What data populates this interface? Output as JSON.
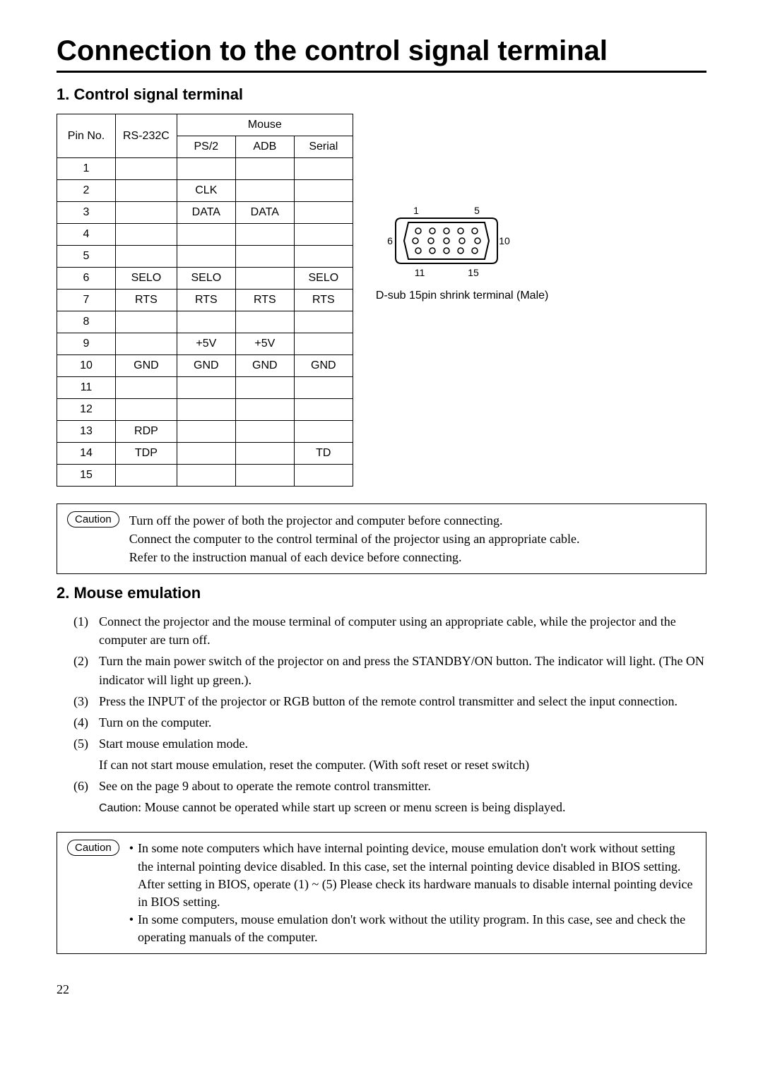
{
  "title": "Connection to the control signal terminal",
  "section1_title": "1. Control signal terminal",
  "table": {
    "headers": {
      "pin_no": "Pin No.",
      "rs232c": "RS-232C",
      "mouse": "Mouse",
      "ps2": "PS/2",
      "adb": "ADB",
      "serial": "Serial"
    },
    "rows": [
      {
        "pin": "1",
        "rs": "",
        "ps2": "",
        "adb": "",
        "ser": ""
      },
      {
        "pin": "2",
        "rs": "",
        "ps2": "CLK",
        "adb": "",
        "ser": ""
      },
      {
        "pin": "3",
        "rs": "",
        "ps2": "DATA",
        "adb": "DATA",
        "ser": ""
      },
      {
        "pin": "4",
        "rs": "",
        "ps2": "",
        "adb": "",
        "ser": ""
      },
      {
        "pin": "5",
        "rs": "",
        "ps2": "",
        "adb": "",
        "ser": ""
      },
      {
        "pin": "6",
        "rs": "SELO",
        "ps2": "SELO",
        "adb": "",
        "ser": "SELO"
      },
      {
        "pin": "7",
        "rs": "RTS",
        "ps2": "RTS",
        "adb": "RTS",
        "ser": "RTS"
      },
      {
        "pin": "8",
        "rs": "",
        "ps2": "",
        "adb": "",
        "ser": ""
      },
      {
        "pin": "9",
        "rs": "",
        "ps2": "+5V",
        "adb": "+5V",
        "ser": ""
      },
      {
        "pin": "10",
        "rs": "GND",
        "ps2": "GND",
        "adb": "GND",
        "ser": "GND"
      },
      {
        "pin": "11",
        "rs": "",
        "ps2": "",
        "adb": "",
        "ser": ""
      },
      {
        "pin": "12",
        "rs": "",
        "ps2": "",
        "adb": "",
        "ser": ""
      },
      {
        "pin": "13",
        "rs": "RDP",
        "ps2": "",
        "adb": "",
        "ser": ""
      },
      {
        "pin": "14",
        "rs": "TDP",
        "ps2": "",
        "adb": "",
        "ser": "TD"
      },
      {
        "pin": "15",
        "rs": "",
        "ps2": "",
        "adb": "",
        "ser": ""
      }
    ]
  },
  "connector": {
    "labels": {
      "p1": "1",
      "p5": "5",
      "p6": "6",
      "p10": "10",
      "p11": "11",
      "p15": "15"
    },
    "caption": "D-sub 15pin shrink terminal (Male)"
  },
  "caution1": {
    "label": "Caution",
    "lines": [
      "Turn off the power of both the projector and computer before connecting.",
      "Connect the computer to the control terminal of the projector using an appropriate cable.",
      "Refer to the instruction manual of each device before connecting."
    ]
  },
  "section2_title": "2. Mouse emulation",
  "mouse_steps": [
    {
      "n": "(1)",
      "t": "Connect the projector and the mouse terminal of computer using an appropriate cable, while the projector and the computer are turn off."
    },
    {
      "n": "(2)",
      "t": "Turn the main power switch of the projector on and press the STANDBY/ON button. The indicator will light. (The ON indicator will light up green.)."
    },
    {
      "n": "(3)",
      "t": "Press the INPUT of the projector or RGB button of the remote control transmitter and select the input connection."
    },
    {
      "n": "(4)",
      "t": "Turn on the computer."
    },
    {
      "n": "(5)",
      "t": "Start mouse emulation mode."
    },
    {
      "n": "",
      "t": "If can not start mouse emulation, reset the computer. (With soft reset or reset switch)",
      "sub": true
    },
    {
      "n": "(6)",
      "t": "See on the page 9 about to operate the remote control transmitter."
    }
  ],
  "caution_inline_label": "Caution",
  "caution_inline_text": ": Mouse cannot be operated while start up screen or menu screen is being displayed.",
  "caution2": {
    "label": "Caution",
    "bullets": [
      "In some note computers which have internal pointing device, mouse emulation don't work without setting the internal pointing device disabled. In this case, set the internal pointing device disabled in BIOS setting. After setting in BIOS, operate (1) ~ (5) Please check its hardware manuals to disable internal pointing device in BIOS setting.",
      "In some computers, mouse emulation don't work without the utility program. In this case, see and check the operating manuals of the computer."
    ]
  },
  "page_number": "22"
}
